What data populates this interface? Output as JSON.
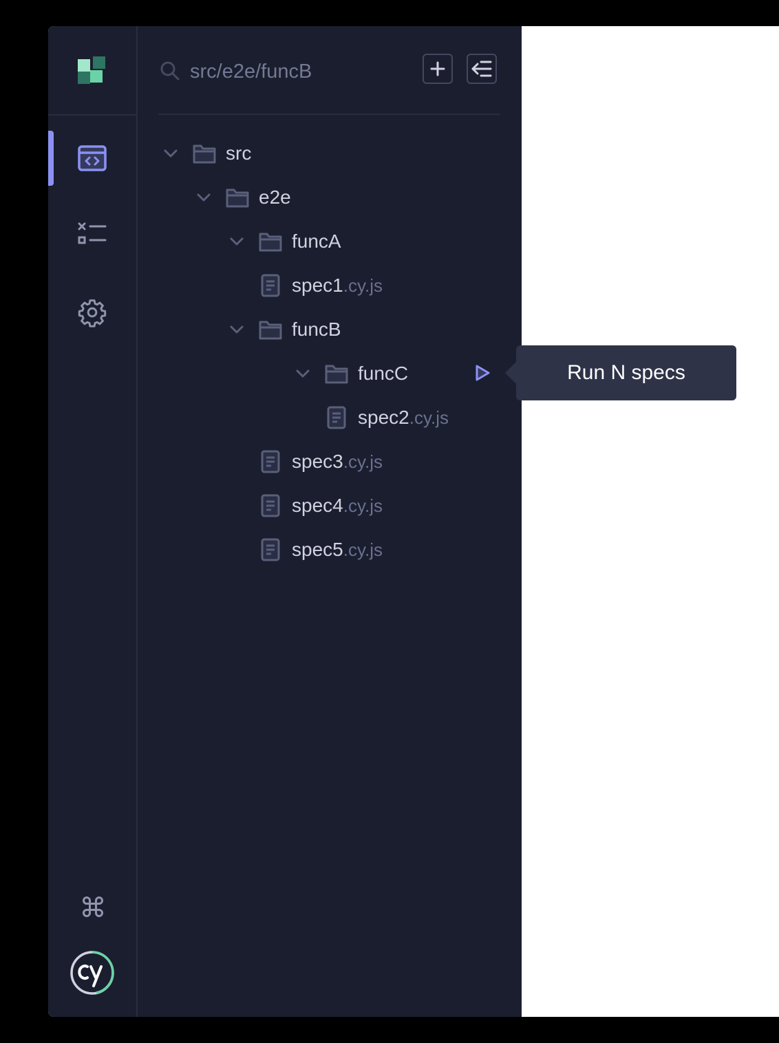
{
  "search": {
    "placeholder": "src/e2e/funcB",
    "value": ""
  },
  "tree": {
    "src": "src",
    "e2e": "e2e",
    "funcA": "funcA",
    "spec1": {
      "name": "spec1",
      "ext": ".cy.js"
    },
    "funcB": "funcB",
    "funcC": "funcC",
    "spec2": {
      "name": "spec2",
      "ext": ".cy.js"
    },
    "spec3": {
      "name": "spec3",
      "ext": ".cy.js"
    },
    "spec4": {
      "name": "spec4",
      "ext": ".cy.js"
    },
    "spec5": {
      "name": "spec5",
      "ext": ".cy.js"
    }
  },
  "tooltip": {
    "text": "Run N specs"
  },
  "colors": {
    "panel_bg": "#1b1e2e",
    "accent": "#8b91f3",
    "text": "#d0d2e0",
    "muted": "#6a7090",
    "icon": "#5a5f7a",
    "tooltip_bg": "#2f3347",
    "logo_green": "#69d3a7"
  },
  "icons": [
    "cypress-app-logo",
    "specs-icon",
    "runs-icon",
    "settings-icon",
    "search-icon",
    "plus-icon",
    "collapse-panel-icon",
    "chevron-down-icon",
    "folder-icon",
    "document-icon",
    "play-icon",
    "command-key-icon",
    "cypress-logo"
  ]
}
